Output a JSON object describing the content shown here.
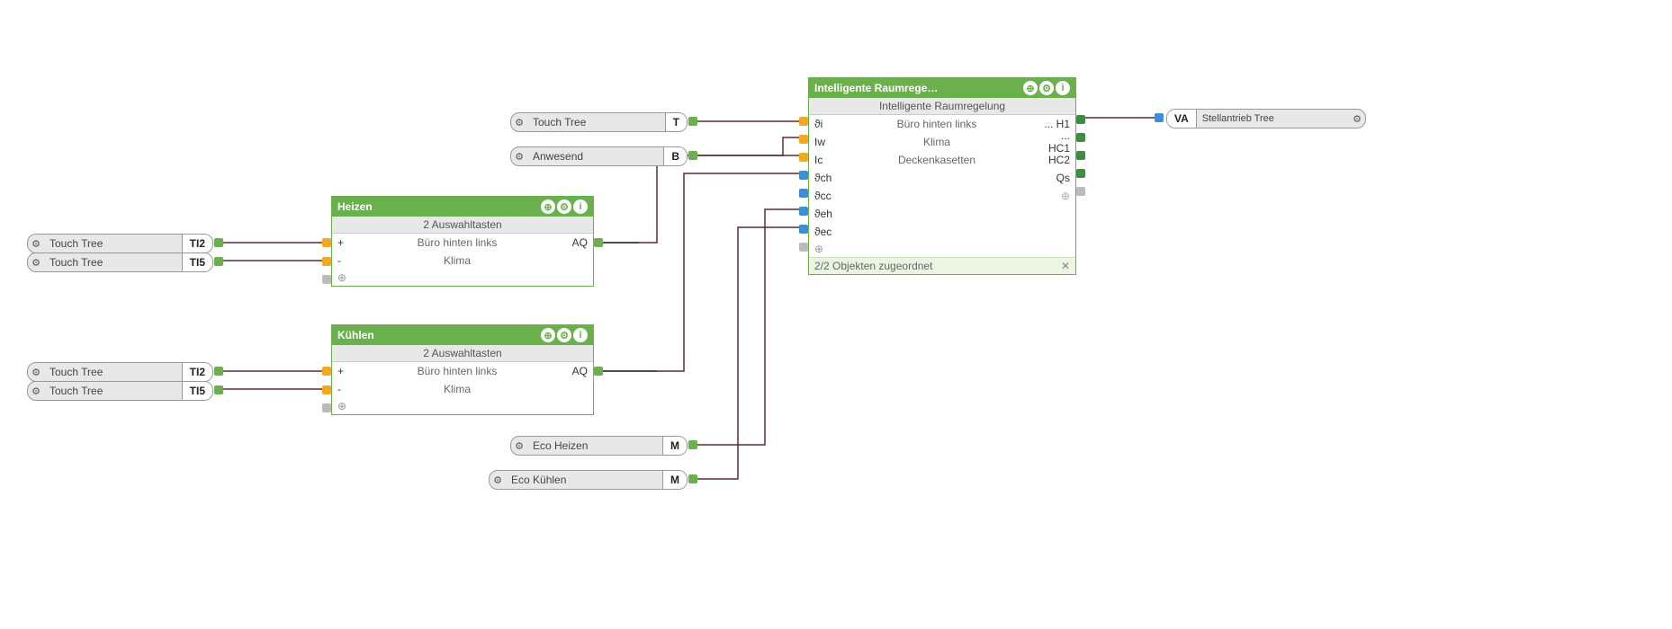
{
  "inputs": {
    "heizen_ti2": {
      "label": "Touch Tree",
      "tag": "TI2"
    },
    "heizen_ti5": {
      "label": "Touch Tree",
      "tag": "TI5"
    },
    "kuehlen_ti2": {
      "label": "Touch Tree",
      "tag": "TI2"
    },
    "kuehlen_ti5": {
      "label": "Touch Tree",
      "tag": "TI5"
    },
    "touch_t": {
      "label": "Touch Tree",
      "tag": "T"
    },
    "anwesend": {
      "label": "Anwesend",
      "tag": "B"
    },
    "eco_heizen": {
      "label": "Eco Heizen",
      "tag": "M"
    },
    "eco_kuehlen": {
      "label": "Eco Kühlen",
      "tag": "M"
    }
  },
  "heizen": {
    "title": "Heizen",
    "subtitle": "2 Auswahltasten",
    "line1": "Büro hinten links",
    "line2": "Klima",
    "plus": "+",
    "minus": "-",
    "out": "AQ"
  },
  "kuehlen": {
    "title": "Kühlen",
    "subtitle": "2 Auswahltasten",
    "line1": "Büro hinten links",
    "line2": "Klima",
    "plus": "+",
    "minus": "-",
    "out": "AQ"
  },
  "room": {
    "title": "Intelligente Raumrege…",
    "subtitle": "Intelligente Raumregelung",
    "line1": "Büro hinten links",
    "line2": "Klima",
    "line3": "Deckenkasetten",
    "in1": "ϑi",
    "in2": "Iw",
    "in3": "Ic",
    "in4": "ϑch",
    "in5": "ϑcc",
    "in6": "ϑeh",
    "in7": "ϑec",
    "out1": "... H1",
    "out2": "... HC1",
    "out3": "HC2",
    "out4": "Qs",
    "footer": "2/2 Objekten zugeordnet"
  },
  "output": {
    "tag": "VA",
    "label": "Stellantrieb Tree"
  },
  "glyphs": {
    "gear": "⚙",
    "plus": "⊕",
    "info": "i",
    "add": "⊕",
    "more": "⊕",
    "arrow": "➜"
  }
}
